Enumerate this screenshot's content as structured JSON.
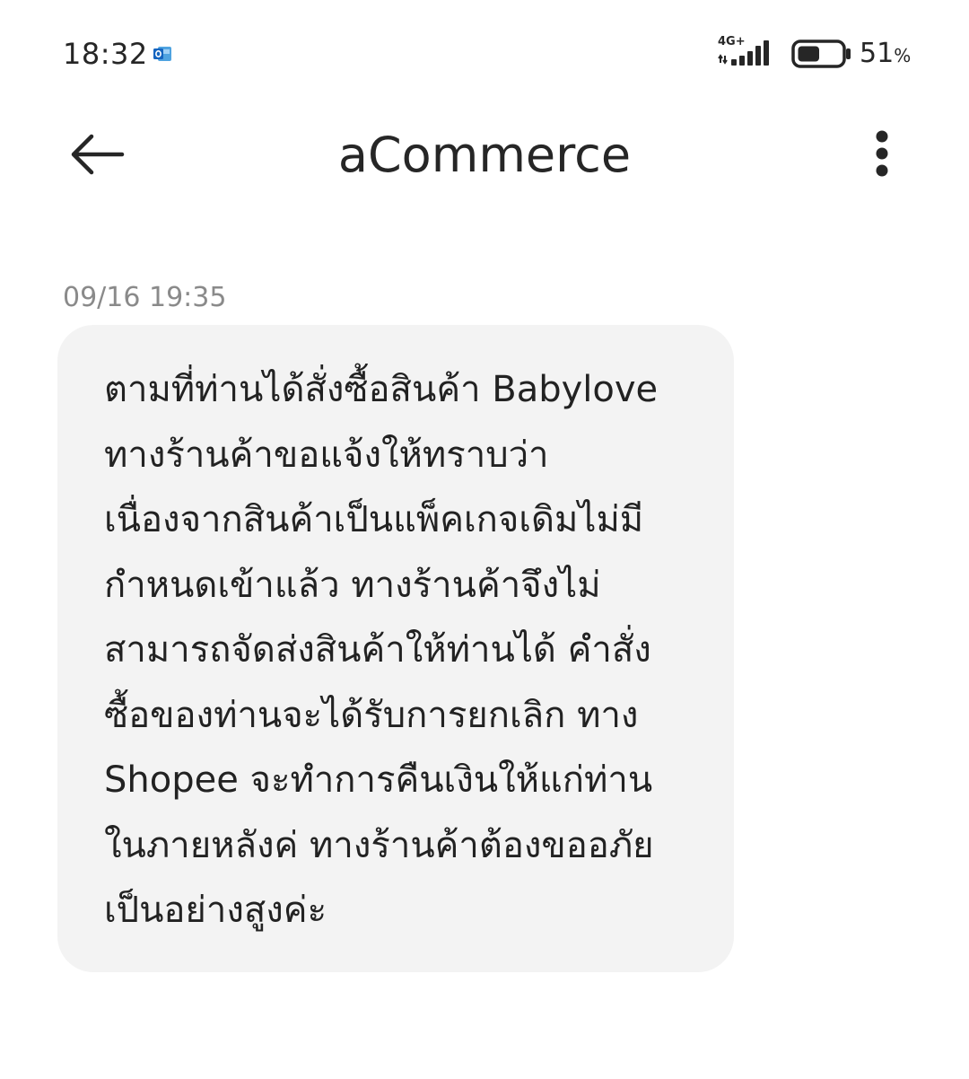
{
  "status_bar": {
    "time": "18:32",
    "notification_icon": "outlook-icon",
    "network_type": "4G+",
    "battery_percent": "51",
    "battery_unit": "%",
    "battery_level": 0.51
  },
  "header": {
    "back_icon": "arrow-left-icon",
    "title": "aCommerce",
    "more_icon": "more-vertical-icon"
  },
  "message": {
    "timestamp": "09/16 19:35",
    "lines": [
      "ตามที่ท่านได้สั่งซื้อสินค้า Babylove",
      "ทางร้านค้าขอแจ้งให้ทราบว่า",
      "เนื่องจากสินค้าเป็นแพ็คเกจเดิมไม่มี",
      "กำหนดเข้าแล้ว ทางร้านค้าจึงไม่",
      "สามารถจัดส่งสินค้าให้ท่านได้ คำสั่ง",
      "ซื้อของท่านจะได้รับการยกเลิก ทาง",
      "Shopee จะทำการคืนเงินให้แก่ท่าน",
      "ในภายหลังค่ ทางร้านค้าต้องขออภัย",
      "เป็นอย่างสูงค่ะ"
    ]
  }
}
